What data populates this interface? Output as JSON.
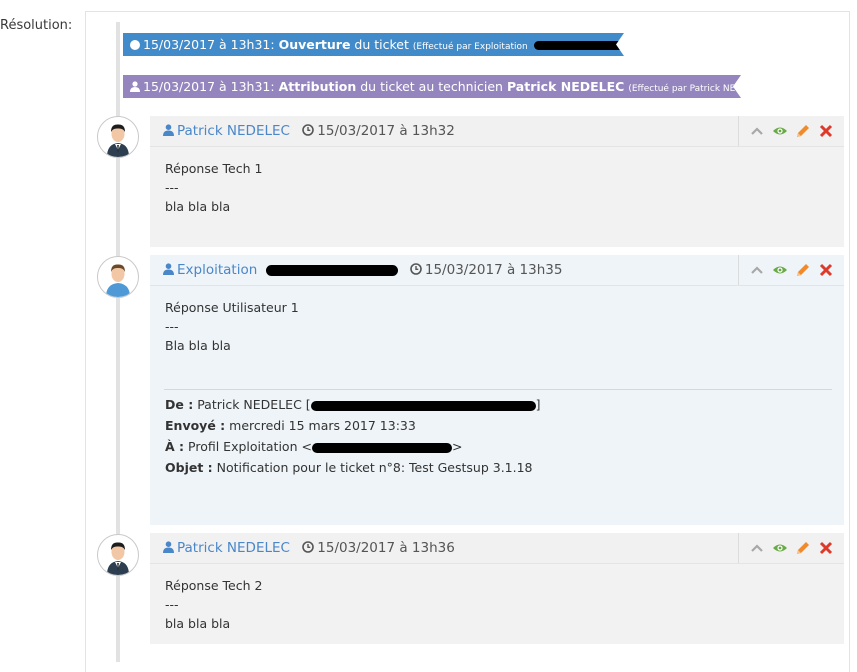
{
  "resolution_label": "Résolution:",
  "events": [
    {
      "date": "15/03/2017 à 13h31:",
      "action": "Ouverture",
      "rest": "du ticket",
      "by": "(Effectué par Exploitation"
    },
    {
      "date": "15/03/2017 à 13h31:",
      "action": "Attribution",
      "rest": "du ticket au technicien",
      "tech": "Patrick NEDELEC",
      "by": "(Effectué par Patrick NEDELEC)"
    }
  ],
  "entries": [
    {
      "author": "Patrick NEDELEC",
      "time": "15/03/2017 à 13h32",
      "lines": [
        "Réponse Tech 1",
        "---",
        "bla bla bla"
      ]
    },
    {
      "author": "Exploitation",
      "time": "15/03/2017 à 13h35",
      "lines": [
        "Réponse Utilisateur 1",
        "---",
        "Bla bla bla"
      ],
      "mail": {
        "from_label": "De :",
        "from_value": "Patrick NEDELEC [",
        "sent_label": "Envoyé :",
        "sent_value": "mercredi 15 mars 2017 13:33",
        "to_label": "À :",
        "to_value": "Profil Exploitation <",
        "subject_label": "Objet :",
        "subject_value": "Notification pour le ticket n°8: Test Gestsup 3.1.18"
      }
    },
    {
      "author": "Patrick NEDELEC",
      "time": "15/03/2017 à 13h36",
      "lines": [
        "Réponse Tech 2",
        "---",
        "bla bla bla"
      ]
    }
  ],
  "colors": {
    "event_open": "#428bca",
    "event_assign": "#9585bf",
    "link": "#4a87c9",
    "view_icon": "#69aa46",
    "edit_icon": "#f08a2a",
    "delete_icon": "#dd3a2c"
  }
}
